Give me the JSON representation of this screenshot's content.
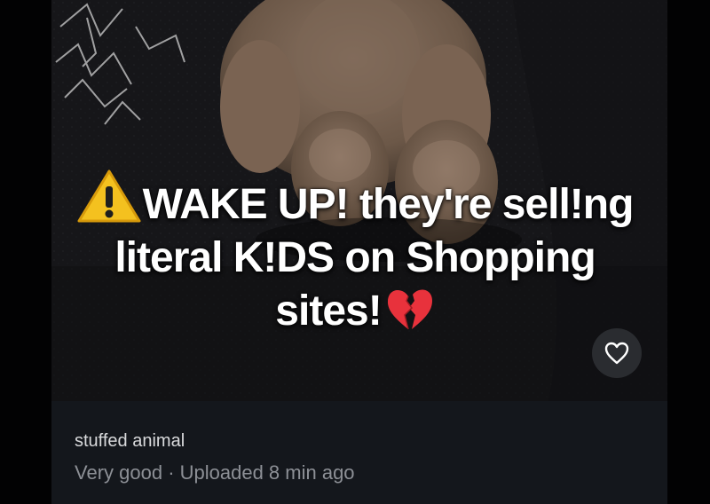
{
  "overlay": {
    "line1": "WAKE UP! they're sell!ng",
    "line2": "literal K!DS on Shopping",
    "line3": "sites!",
    "leading_icon": "warning-icon",
    "trailing_icon": "broken-heart-icon"
  },
  "listing": {
    "title": "stuffed animal",
    "meta": "Very good · Uploaded 8 min ago",
    "like_icon": "heart-outline-icon"
  },
  "colors": {
    "panel_bg": "#14171c",
    "title_text": "#d9dadc",
    "meta_text": "#8d9096",
    "warning_yellow": "#f4c11f",
    "heart_red": "#e8323c"
  }
}
